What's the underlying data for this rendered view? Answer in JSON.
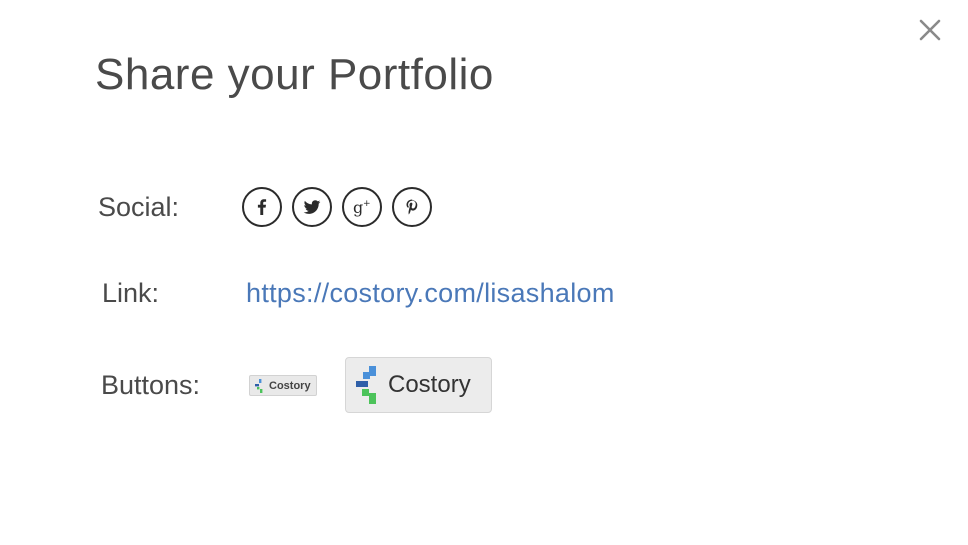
{
  "dialog": {
    "title": "Share your Portfolio",
    "close_icon": "close-icon"
  },
  "social": {
    "label": "Social:",
    "icons": [
      {
        "name": "facebook-icon",
        "glyph": "f"
      },
      {
        "name": "twitter-icon",
        "glyph": "bird"
      },
      {
        "name": "google-plus-icon",
        "glyph": "g+"
      },
      {
        "name": "pinterest-icon",
        "glyph": "p"
      }
    ]
  },
  "link": {
    "label": "Link:",
    "url": "https://costory.com/lisashalom"
  },
  "buttons": {
    "label": "Buttons:",
    "small_button_text": "Costory",
    "large_button_text": "Costory"
  },
  "colors": {
    "text": "#4a4a4a",
    "link": "#4a78b8",
    "logo_blue": "#4a90d9",
    "logo_green": "#4cc35a",
    "logo_dark": "#2f5fa8"
  }
}
